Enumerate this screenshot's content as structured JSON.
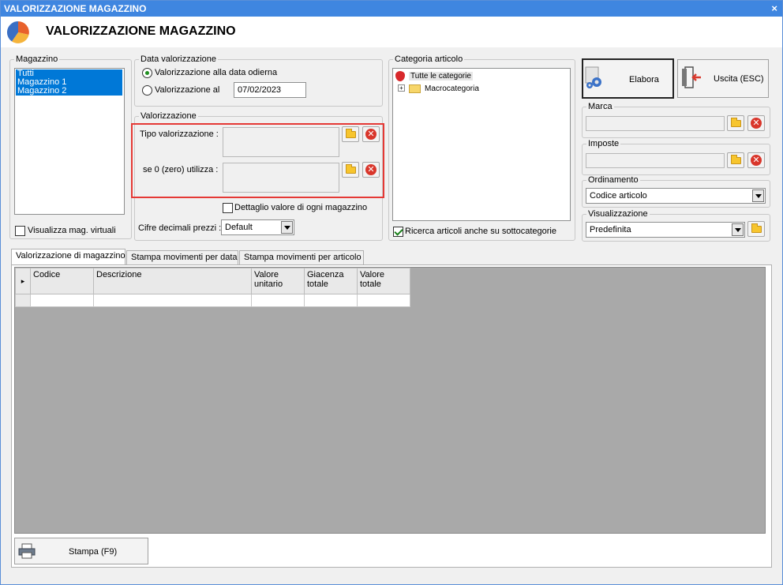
{
  "window": {
    "title": "VALORIZZAZIONE MAGAZZINO",
    "close": "×"
  },
  "header": {
    "title": "VALORIZZAZIONE MAGAZZINO",
    "logo_icon": "pie-chart-icon"
  },
  "magazzino": {
    "legend": "Magazzino",
    "items": [
      "Tutti",
      "Magazzino 1",
      "Magazzino 2"
    ],
    "virtual_label": "Visualizza mag. virtuali",
    "virtual_checked": false
  },
  "data_valorizzazione": {
    "legend": "Data valorizzazione",
    "option1": "Valorizzazione alla data odierna",
    "option2": "Valorizzazione al",
    "date_value": "07/02/2023",
    "selected": 1
  },
  "valorizzazione": {
    "legend": "Valorizzazione",
    "tipo_label": "Tipo valorizzazione :",
    "zero_label": "se 0 (zero) utilizza :",
    "highlight_color": "#e53935"
  },
  "options": {
    "dettaglio_label": "Dettaglio valore di ogni magazzino",
    "dettaglio_checked": false,
    "cifre_label": "Cifre decimali prezzi :",
    "cifre_value": "Default"
  },
  "categoria": {
    "legend": "Categoria articolo",
    "root": "Tutte le categorie",
    "child": "Macrocategoria",
    "expander": "+",
    "ricerca_label": "Ricerca articoli anche su sottocategorie",
    "ricerca_checked": true
  },
  "buttons": {
    "elabora": "Elabora",
    "uscita": "Uscita (ESC)",
    "stampa": "Stampa (F9)"
  },
  "marca": {
    "legend": "Marca"
  },
  "imposte": {
    "legend": "Imposte"
  },
  "ordinamento": {
    "legend": "Ordinamento",
    "value": "Codice articolo"
  },
  "visualizzazione": {
    "legend": "Visualizzazione",
    "value": "Predefinita"
  },
  "tabs": [
    {
      "label": "Valorizzazione di magazzino",
      "active": true
    },
    {
      "label": "Stampa movimenti per data",
      "active": false
    },
    {
      "label": "Stampa movimenti per articolo",
      "active": false
    }
  ],
  "grid": {
    "columns": [
      "Codice",
      "Descrizione",
      "Valore unitario",
      "Giacenza totale",
      "Valore totale"
    ],
    "row_indicator": "▸"
  }
}
